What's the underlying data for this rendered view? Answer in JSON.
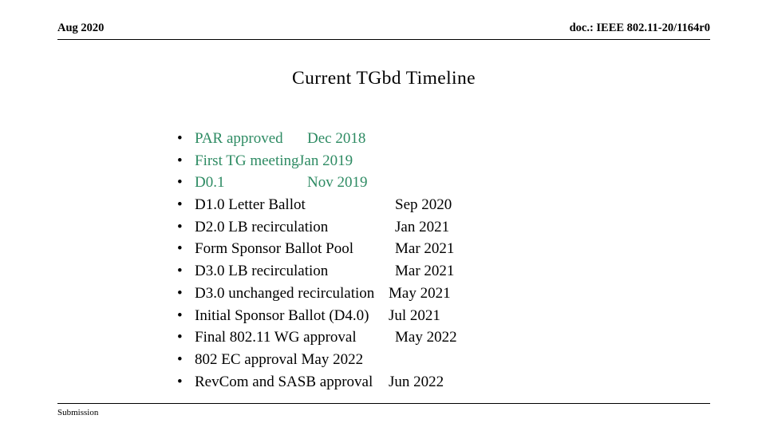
{
  "header": {
    "left_text": "Aug 2020",
    "right_text": "doc.: IEEE 802.11-20/1164r0"
  },
  "title": "Current TGbd Timeline",
  "colors": {
    "green_text": "#2e8b63",
    "black_text": "#000000",
    "rule": "#000000",
    "background": "#ffffff"
  },
  "bullets": [
    {
      "marker": "•",
      "label": "PAR approved",
      "date": "Dec 2018",
      "color": "green",
      "date_style": "dt-p1"
    },
    {
      "marker": "•",
      "label": "First TG meeting",
      "date": "Jan 2019",
      "color": "green",
      "date_style": "dt-p2"
    },
    {
      "marker": "•",
      "label": "D0.1",
      "date": "Nov 2019",
      "color": "green",
      "date_style": "dt-p3"
    },
    {
      "marker": "•",
      "label": "D1.0 Letter Ballot",
      "date": "Sep 2020",
      "color": "black",
      "date_style": "dt-col"
    },
    {
      "marker": "•",
      "label": "D2.0 LB recirculation",
      "date": "Jan 2021",
      "color": "black",
      "date_style": "dt-col"
    },
    {
      "marker": "•",
      "label": "Form Sponsor Ballot Pool",
      "date": "Mar 2021",
      "color": "black",
      "date_style": "dt-col"
    },
    {
      "marker": "•",
      "label": "D3.0 LB recirculation",
      "date": "Mar 2021",
      "color": "black",
      "date_style": "dt-col"
    },
    {
      "marker": "•",
      "label": "D3.0 unchanged recirculation",
      "date": "May 2021",
      "color": "black",
      "date_style": "dt-nar"
    },
    {
      "marker": "•",
      "label": "Initial Sponsor Ballot (D4.0)",
      "date": "Jul 2021",
      "color": "black",
      "date_style": "dt-nar"
    },
    {
      "marker": "•",
      "label": "Final 802.11 WG approval",
      "date": "May 2022",
      "color": "black",
      "date_style": "dt-col"
    },
    {
      "marker": "•",
      "label": "802 EC approval May 2022",
      "date": "",
      "color": "black",
      "date_style": "dt-none"
    },
    {
      "marker": "•",
      "label": "RevCom and SASB approval",
      "date": "Jun 2022",
      "color": "black",
      "date_style": "dt-nar"
    }
  ],
  "footer": {
    "left_text": "Submission",
    "right_text": ""
  }
}
